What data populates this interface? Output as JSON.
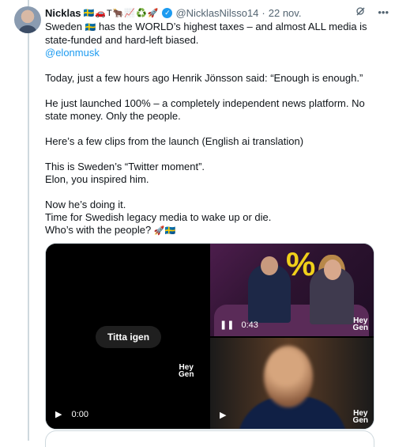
{
  "tweet": {
    "display_name": "Nicklas",
    "name_emojis": "🇸🇪🚗T🐂📈♻️🚀",
    "handle": "@NicklasNilsso14",
    "separator": "·",
    "date": "22 nov.",
    "icons": {
      "grok": "grok-icon",
      "more": "more-icon"
    },
    "lines": [
      "Sweden",
      "has the WORLD’s highest taxes – and almost ALL media is state-funded and hard-left biased.",
      "@elonmusk",
      "Today, just a few hours ago Henrik Jönsson said: “Enough is enough.”",
      "He just launched 100% – a completely independent news platform. No state money. Only the people.",
      "Here’s a few clips from the launch (English ai translation)",
      "This is Sweden’s “Twitter moment”.",
      "Elon, you inspired him.",
      "Now he’s doing it.",
      "Time for Swedish legacy media to wake up or die.",
      "Who’s with the people?"
    ],
    "inline_emojis": {
      "flag": "🇸🇪",
      "rocket_flag": "🚀🇸🇪"
    }
  },
  "media": {
    "main_video": {
      "replay_label": "Titta igen",
      "brand": [
        "Hey",
        "Gen"
      ],
      "time": "0:00"
    },
    "thumb_top": {
      "sign": "%",
      "time": "0:43",
      "brand": [
        "Hey",
        "Gen"
      ]
    },
    "thumb_bottom": {
      "brand": [
        "Hey",
        "Gen"
      ]
    }
  },
  "colors": {
    "accent": "#1d9bf0",
    "text": "#0f1419",
    "muted": "#536471",
    "border": "#cfd9de"
  }
}
